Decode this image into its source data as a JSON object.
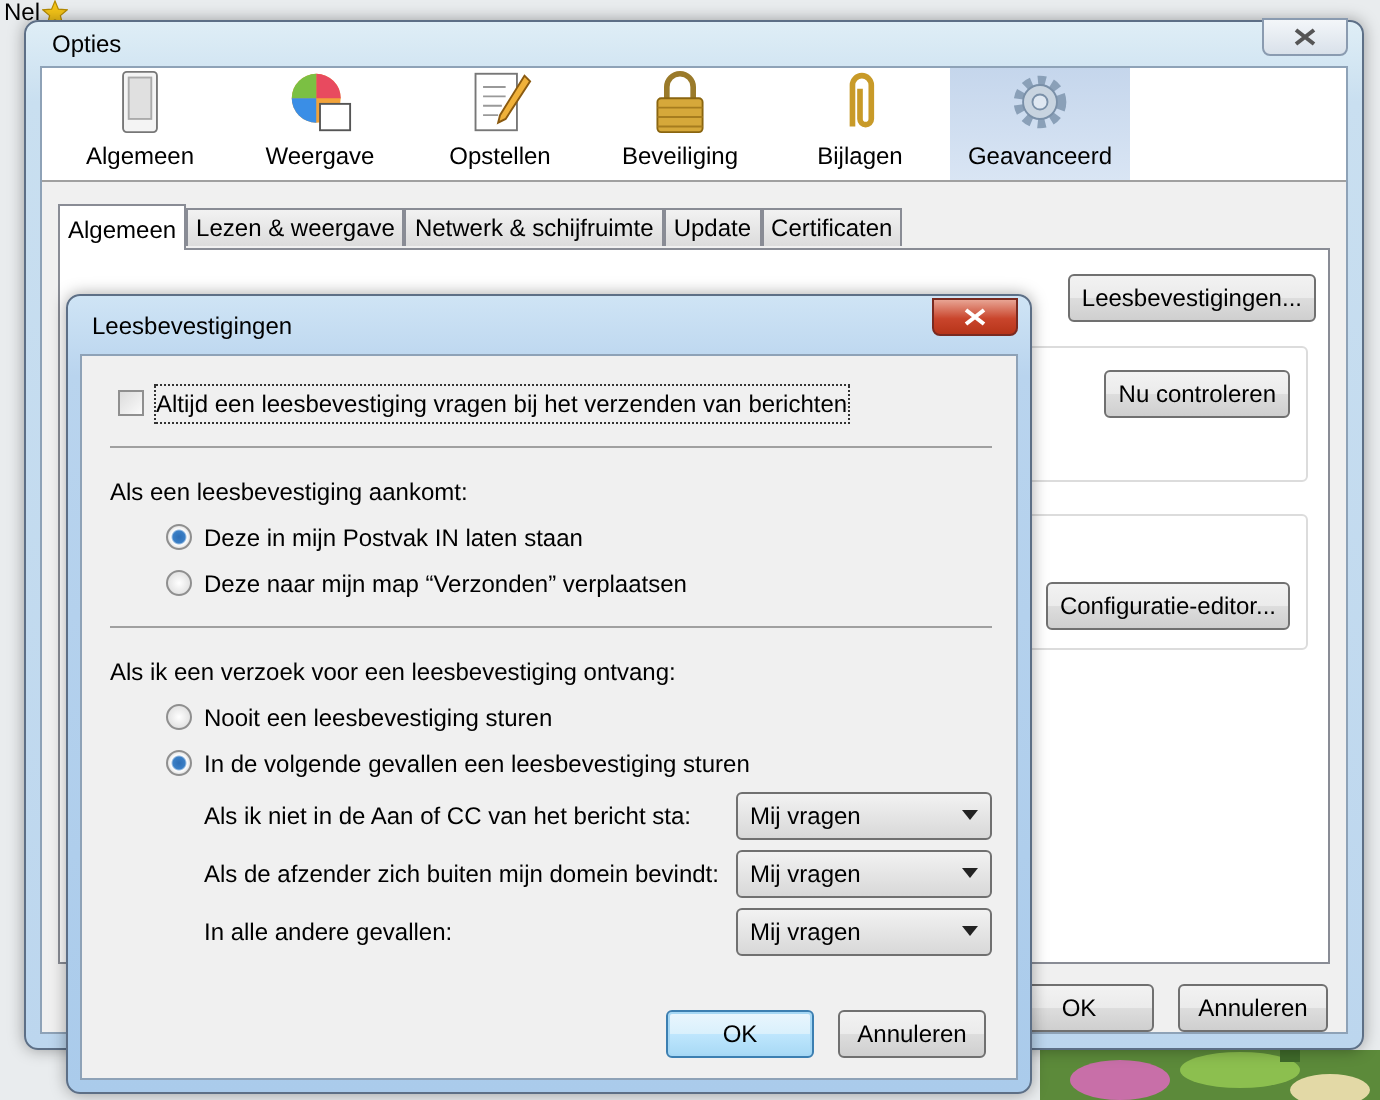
{
  "desktop": {
    "label": "Nel"
  },
  "window": {
    "title": "Opties"
  },
  "toolbar": [
    {
      "label": "Algemeen",
      "kind": "switch",
      "selected": false
    },
    {
      "label": "Weergave",
      "kind": "palette",
      "selected": false
    },
    {
      "label": "Opstellen",
      "kind": "compose",
      "selected": false
    },
    {
      "label": "Beveiliging",
      "kind": "lock",
      "selected": false
    },
    {
      "label": "Bijlagen",
      "kind": "clip",
      "selected": false
    },
    {
      "label": "Geavanceerd",
      "kind": "gear",
      "selected": true
    }
  ],
  "tabs": [
    {
      "label": "Algemeen",
      "selected": true
    },
    {
      "label": "Lezen & weergave",
      "selected": false
    },
    {
      "label": "Netwerk & schijfruimte",
      "selected": false
    },
    {
      "label": "Update",
      "selected": false
    },
    {
      "label": "Certificaten",
      "selected": false
    }
  ],
  "panel_buttons": [
    "Leesbevestigingen...",
    "Nu controleren",
    "Configuratie-editor..."
  ],
  "buttons": [
    "OK",
    "Annuleren"
  ],
  "dialog": {
    "title": "Leesbevestigingen",
    "always_request": {
      "label": "Altijd een leesbevestiging vragen bij het verzenden van berichten",
      "checked": false
    },
    "arrival": {
      "heading": "Als een leesbevestiging aankomt:",
      "options": [
        {
          "label": "Deze in mijn Postvak IN laten staan",
          "selected": true
        },
        {
          "label": "Deze naar mijn map “Verzonden” verplaatsen",
          "selected": false
        }
      ]
    },
    "request": {
      "heading": "Als ik een verzoek voor een leesbevestiging ontvang:",
      "options": [
        {
          "label": "Nooit een leesbevestiging sturen",
          "selected": false
        },
        {
          "label": "In de volgende gevallen een leesbevestiging sturen",
          "selected": true
        }
      ]
    },
    "rules": [
      {
        "label": "Als ik niet in de Aan of CC van het bericht sta:",
        "value": "Mij vragen"
      },
      {
        "label": "Als de afzender zich buiten mijn domein bevindt:",
        "value": "Mij vragen"
      },
      {
        "label": "In alle andere gevallen:",
        "value": "Mij vragen"
      }
    ],
    "buttons": [
      {
        "label": "OK",
        "default": true
      },
      {
        "label": "Annuleren",
        "default": false
      }
    ]
  }
}
